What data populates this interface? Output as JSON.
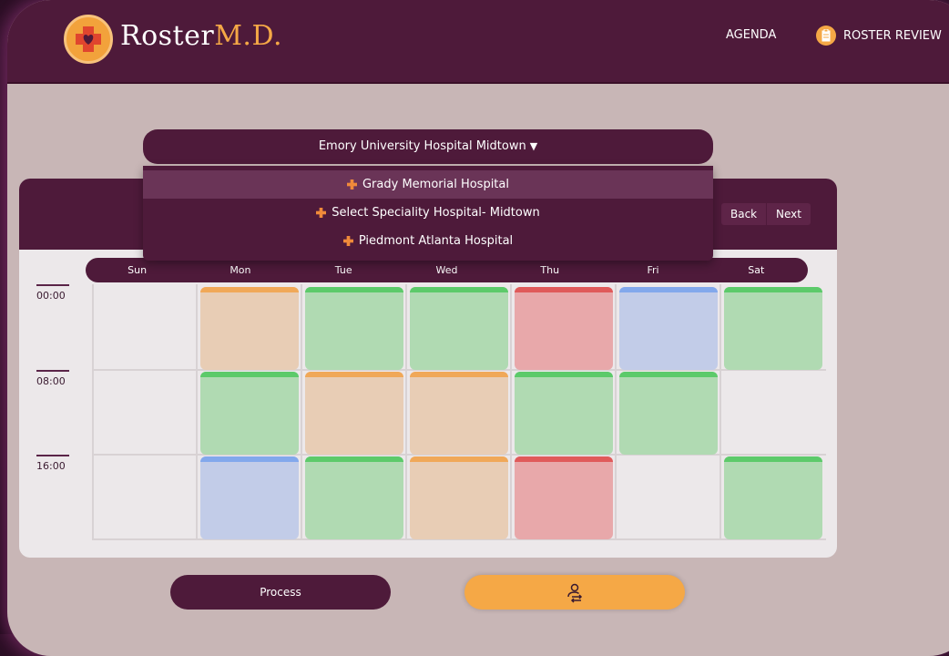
{
  "app": {
    "logo_main": "Roster",
    "logo_accent": "M.D."
  },
  "nav": {
    "agenda_label": "AGENDA",
    "roster_review_label": "ROSTER REVIEW"
  },
  "hospital_select": {
    "selected": "Emory University Hospital Midtown",
    "options": [
      "Grady Memorial Hospital",
      "Select Speciality Hospital- Midtown",
      "Piedmont Atlanta Hospital"
    ]
  },
  "calendar": {
    "back_label": "Back",
    "next_label": "Next",
    "days": [
      "Sun",
      "Mon",
      "Tue",
      "Wed",
      "Thu",
      "Fri",
      "Sat"
    ],
    "times": [
      "00:00",
      "08:00",
      "16:00"
    ],
    "shifts": [
      [
        "none",
        "orange",
        "green",
        "green",
        "red",
        "blue",
        "green"
      ],
      [
        "none",
        "green",
        "orange",
        "orange",
        "green",
        "green",
        "none"
      ],
      [
        "none",
        "blue",
        "green",
        "orange",
        "red",
        "none",
        "green"
      ]
    ]
  },
  "colors": {
    "brand": "#4e1a3a",
    "accent": "#f5a846",
    "orange_fill": "#e8cdb5",
    "orange_top": "#f0a858",
    "green_fill": "#b0dab2",
    "green_top": "#5cca6a",
    "red_fill": "#e8a8aa",
    "red_top": "#e05a5a",
    "blue_fill": "#c2cce8",
    "blue_top": "#82a8ec"
  },
  "actions": {
    "process_label": "Process",
    "swap_icon": "user-swap-icon"
  }
}
